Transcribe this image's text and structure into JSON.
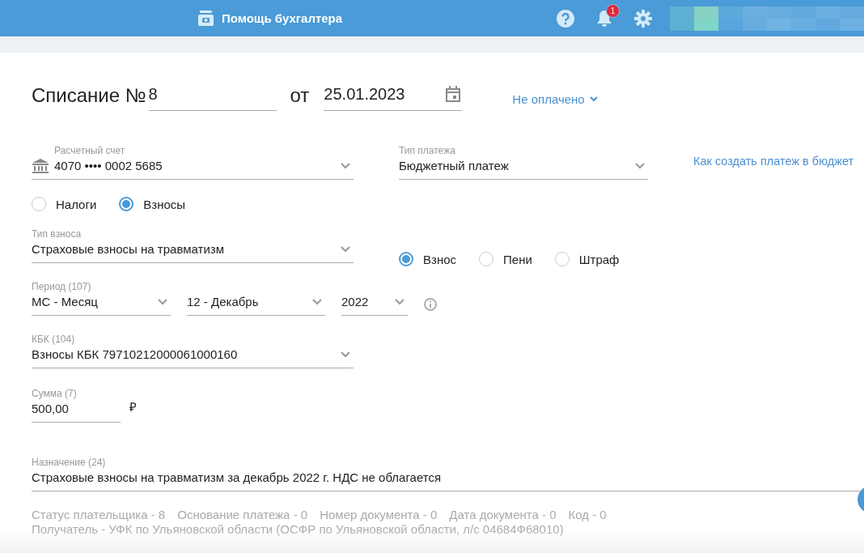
{
  "header": {
    "title": "Помощь бухгалтера",
    "notifications": "1"
  },
  "document": {
    "title": "Списание №",
    "number": "8",
    "date_label": "от",
    "date": "25.01.2023",
    "status": "Не оплачено"
  },
  "account": {
    "label": "Расчетный счет",
    "value": "4070 •••• 0002 5685"
  },
  "payment_type": {
    "label": "Тип платежа",
    "value": "Бюджетный платеж"
  },
  "help_link": "Как создать платеж в бюджет",
  "category_options": [
    {
      "label": "Налоги",
      "selected": false
    },
    {
      "label": "Взносы",
      "selected": true
    }
  ],
  "contribution_type": {
    "label": "Тип взноса",
    "value": "Страховые взносы на травматизм"
  },
  "charge_options": [
    {
      "label": "Взнос",
      "selected": true
    },
    {
      "label": "Пени",
      "selected": false
    },
    {
      "label": "Штраф",
      "selected": false
    }
  ],
  "period": {
    "label": "Период (107)",
    "type": "МС - Месяц",
    "month": "12 - Декабрь",
    "year": "2022"
  },
  "kbk": {
    "label": "КБК (104)",
    "value": "Взносы КБК 79710212000061000160"
  },
  "amount": {
    "label": "Сумма (7)",
    "value": "500,00",
    "currency": "₽"
  },
  "purpose": {
    "label": "Назначение (24)",
    "value": "Страховые взносы на травматизм за декабрь 2022 г. НДС не облагается"
  },
  "details": [
    "Статус плательщика - 8",
    "Основание платежа - 0",
    "Номер документа - 0",
    "Дата документа - 0",
    "Код - 0"
  ],
  "recipient": "Получатель - УФК по Ульяновской области (ОСФР по Ульяновской области, л/с 04684Ф68010)"
}
